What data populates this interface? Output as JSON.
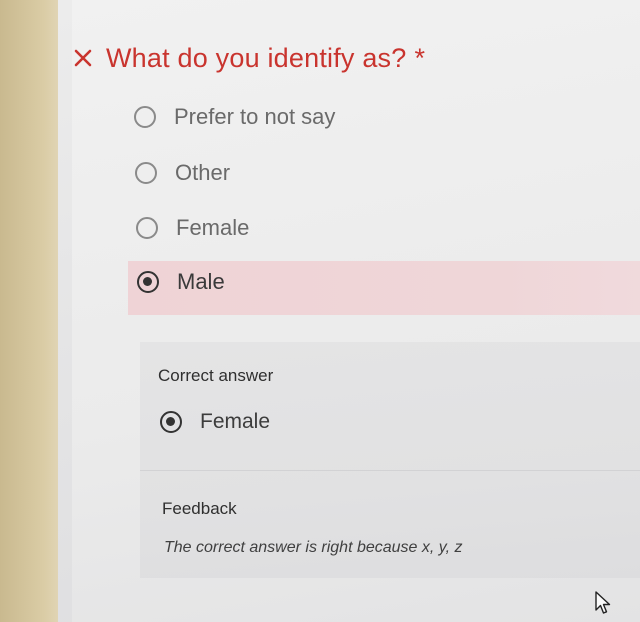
{
  "question": {
    "title": "What do you identify as?",
    "required_marker": "*",
    "status_icon": "x-icon",
    "status_color": "#c9342e",
    "options": [
      {
        "label": "Prefer to not say",
        "selected": false
      },
      {
        "label": "Other",
        "selected": false
      },
      {
        "label": "Female",
        "selected": false
      },
      {
        "label": "Male",
        "selected": true
      }
    ]
  },
  "correct_answer": {
    "heading": "Correct answer",
    "answer": "Female"
  },
  "feedback": {
    "heading": "Feedback",
    "text": "The correct answer is right because x, y, z"
  },
  "colors": {
    "incorrect_highlight": "#efd3d6",
    "panel": "#e1e1e2"
  }
}
